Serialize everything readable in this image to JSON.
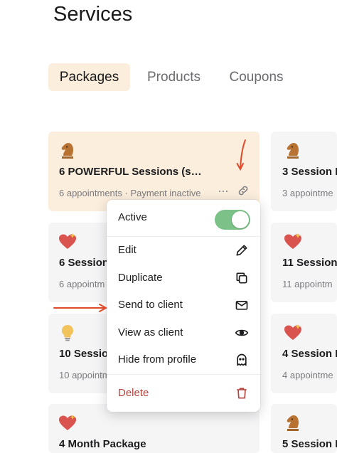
{
  "page": {
    "title": "Services"
  },
  "tabs": [
    {
      "label": "Packages",
      "active": true
    },
    {
      "label": "Products",
      "active": false
    },
    {
      "label": "Coupons",
      "active": false
    }
  ],
  "cards_left": [
    {
      "icon": "chess-knight-icon",
      "title": "6 POWERFUL Sessions (s…",
      "meta": "6 appointments · Payment inactive"
    },
    {
      "icon": "heart-sparkle-icon",
      "title": "6 Session",
      "meta": "6 appointm"
    },
    {
      "icon": "lightbulb-icon",
      "title": "10 Sessio",
      "meta": "10 appointm"
    },
    {
      "icon": "heart-sparkle-icon",
      "title": "4 Month Package",
      "meta": ""
    }
  ],
  "cards_right": [
    {
      "icon": "chess-knight-icon",
      "title": "3 Session P",
      "meta": "3 appointme"
    },
    {
      "icon": "heart-sparkle-icon",
      "title": "11 Session",
      "meta": "11 appointm"
    },
    {
      "icon": "heart-sparkle-icon",
      "title": "4 Session P",
      "meta": "4 appointme"
    },
    {
      "icon": "chess-knight-icon",
      "title": "5 Session P",
      "meta": ""
    }
  ],
  "card_actions": {
    "more": "···",
    "link_icon": "link-icon"
  },
  "menu": {
    "active_label": "Active",
    "active_on": true,
    "items": [
      {
        "label": "Edit",
        "icon": "pencil-icon"
      },
      {
        "label": "Duplicate",
        "icon": "copy-icon"
      },
      {
        "label": "Send to client",
        "icon": "envelope-icon"
      },
      {
        "label": "View as client",
        "icon": "eye-icon"
      },
      {
        "label": "Hide from profile",
        "icon": "ghost-icon"
      }
    ],
    "delete_label": "Delete",
    "delete_icon": "trash-icon"
  },
  "colors": {
    "accent_tab_bg": "#fbeedd",
    "toggle_on": "#7cc288",
    "delete": "#b5453f",
    "annotation_arrow": "#e04a2a",
    "heart": "#d9534f",
    "knight": "#a0642d",
    "bulb": "#f2c35b"
  }
}
